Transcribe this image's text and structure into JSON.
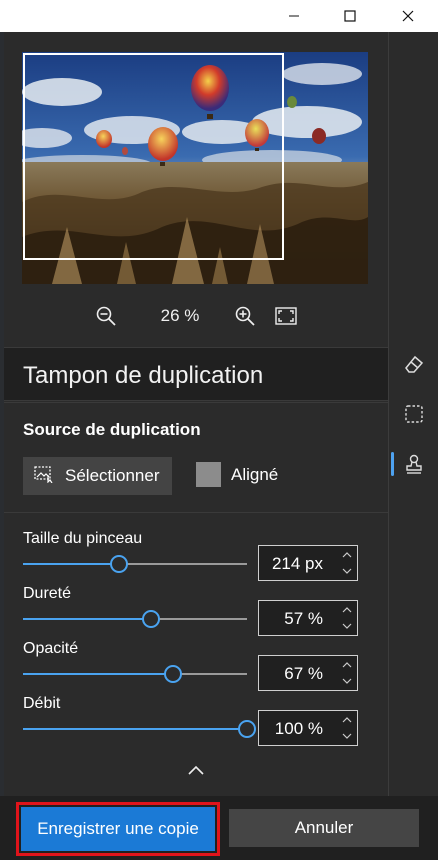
{
  "window": {
    "controls": [
      "minimize-icon",
      "maximize-icon",
      "close-icon"
    ]
  },
  "zoom": {
    "value": "26 %",
    "icons": [
      "zoom-out-icon",
      "zoom-in-icon",
      "fit-screen-icon"
    ]
  },
  "tool": {
    "title": "Tampon de duplication"
  },
  "source": {
    "title": "Source de duplication",
    "select_label": "Sélectionner",
    "select_icon": "image-select-icon",
    "aligned_label": "Aligné",
    "aligned_checked": false
  },
  "sliders": [
    {
      "label": "Taille du pinceau",
      "value": "214 px",
      "level": 0.43
    },
    {
      "label": "Dureté",
      "value": "57 %",
      "level": 0.57
    },
    {
      "label": "Opacité",
      "value": "67 %",
      "level": 0.67
    },
    {
      "label": "Débit",
      "value": "100 %",
      "level": 1.0
    }
  ],
  "rail": {
    "items": [
      "eraser-icon",
      "marquee-select-icon",
      "stamp-icon"
    ],
    "active": "stamp-icon"
  },
  "actions": {
    "save_label": "Enregistrer une copie",
    "cancel_label": "Annuler"
  },
  "colors": {
    "accent": "#4aa3f0",
    "primary_button": "#1b7ad6",
    "highlight_border": "#e0141b"
  }
}
